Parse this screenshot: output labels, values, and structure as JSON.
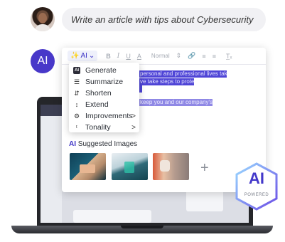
{
  "prompt": {
    "text": "Write an article with tips about Cybersecurity"
  },
  "ai_avatar": {
    "label": "AI"
  },
  "toolbar": {
    "ai_label": "AI",
    "bold": "B",
    "italic": "I",
    "underline": "U",
    "text_color": "A",
    "style": "Normal"
  },
  "editor": {
    "lines": [
      "personal and professional lives taking",
      "ve take steps to protect",
      "",
      "keep you and our company's"
    ]
  },
  "menu": {
    "items": [
      {
        "label": "Generate",
        "icon": "ai-badge-icon",
        "submenu": false
      },
      {
        "label": "Summarize",
        "icon": "summarize-icon",
        "submenu": false
      },
      {
        "label": "Shorten",
        "icon": "shorten-icon",
        "submenu": false
      },
      {
        "label": "Extend",
        "icon": "extend-icon",
        "submenu": false
      },
      {
        "label": "Improvements",
        "icon": "improvements-icon",
        "submenu": true
      },
      {
        "label": "Tonality",
        "icon": "tonality-icon",
        "submenu": true
      }
    ],
    "ai_badge_text": "AI",
    "submenu_arrow": ">"
  },
  "suggested_images": {
    "ai_tag": "AI",
    "title": "Suggested Images",
    "add_symbol": "+"
  },
  "badge": {
    "title": "AI",
    "subtitle": "POWERED"
  },
  "colors": {
    "accent": "#4838c9",
    "selection": "#4f45d6"
  }
}
